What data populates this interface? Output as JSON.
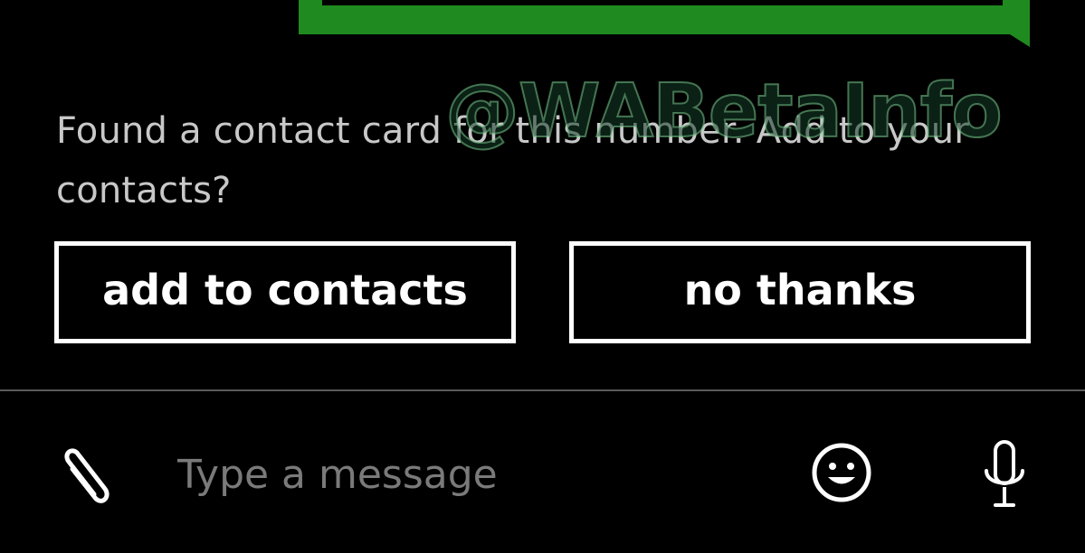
{
  "prompt": {
    "text": "Found a contact card for this number. Add to your contacts?"
  },
  "actions": {
    "add_label": "add to contacts",
    "dismiss_label": "no thanks"
  },
  "composer": {
    "placeholder": "Type a message",
    "attach_icon": "paperclip-icon",
    "emoji_icon": "smiley-icon",
    "mic_icon": "microphone-icon"
  },
  "watermark": {
    "text": "@WABetaInfo"
  },
  "colors": {
    "background": "#000000",
    "bubble_accent": "#1f8a1f",
    "prompt_text": "#c8c8c8",
    "placeholder_text": "#7a7a7a",
    "divider": "#5a5a5a"
  }
}
